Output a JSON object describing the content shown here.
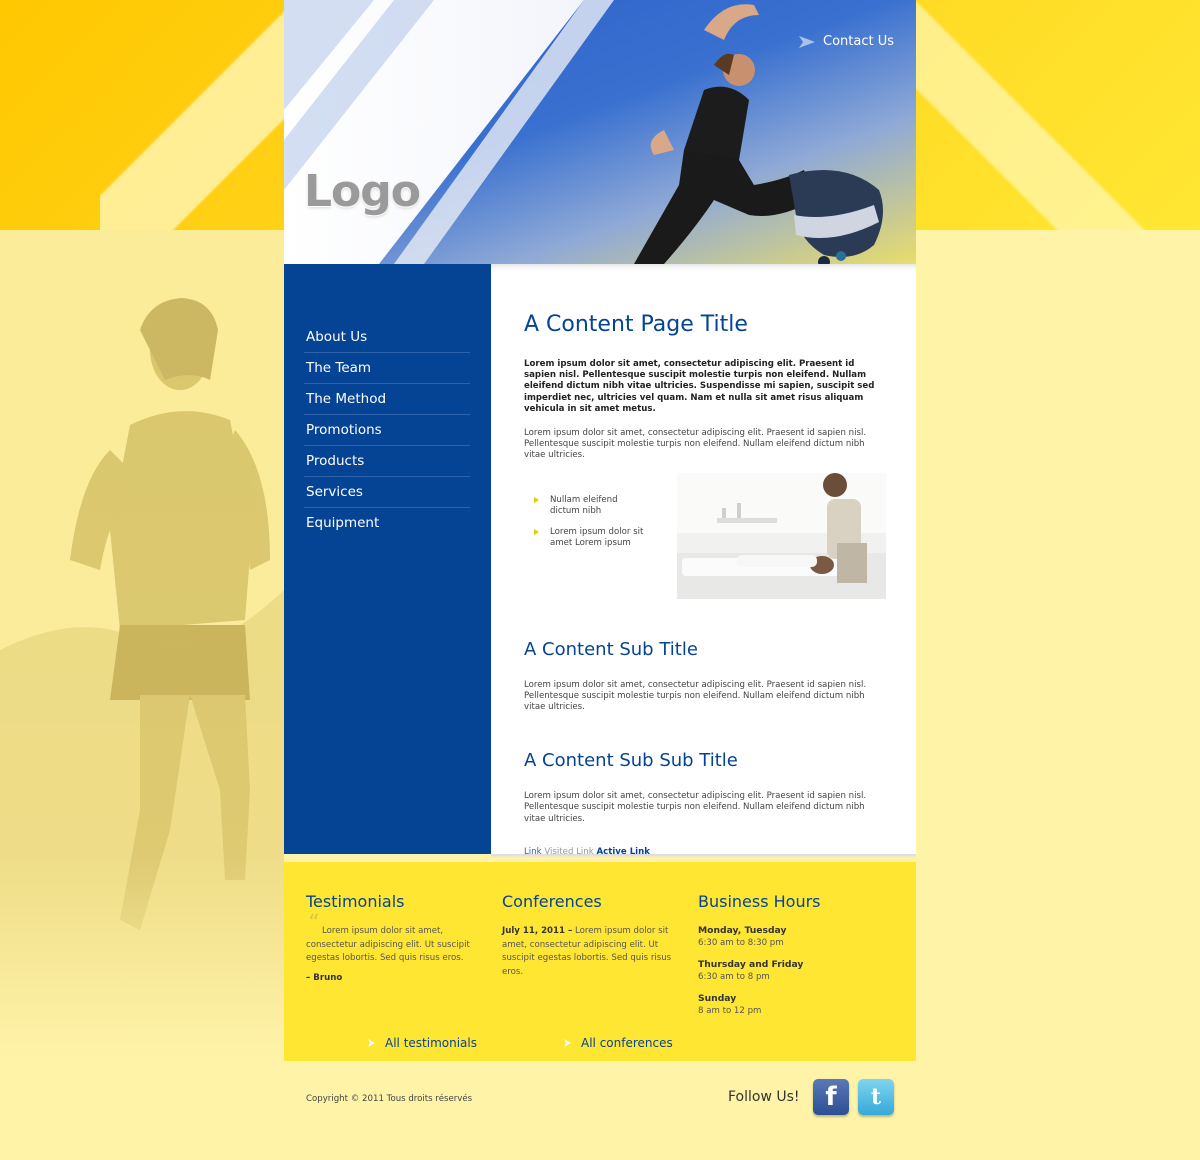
{
  "header": {
    "logo": "Logo",
    "contact_label": "Contact Us"
  },
  "nav": {
    "items": [
      {
        "label": "About Us"
      },
      {
        "label": "The Team"
      },
      {
        "label": "The Method"
      },
      {
        "label": "Promotions"
      },
      {
        "label": "Products"
      },
      {
        "label": "Services"
      },
      {
        "label": "Equipment"
      }
    ]
  },
  "content": {
    "title": "A Content Page Title",
    "lead": "Lorem ipsum dolor sit amet, consectetur adipiscing elit. Praesent id sapien nisl. Pellentesque suscipit molestie turpis non eleifend. Nullam eleifend dictum nibh vitae ultricies. Suspendisse mi sapien, suscipit sed imperdiet nec, ultricies vel quam. Nam et nulla sit amet risus aliquam vehicula in sit amet metus.",
    "intro": "Lorem ipsum dolor sit amet, consectetur adipiscing elit. Praesent id sapien nisl. Pellentesque suscipit molestie turpis non eleifend. Nullam eleifend dictum nibh vitae ultricies.",
    "bullets": [
      "Nullam eleifend dictum nibh",
      "Lorem ipsum dolor sit amet Lorem ipsum"
    ],
    "subtitle": "A Content Sub Title",
    "sub_para": "Lorem ipsum dolor sit amet, consectetur adipiscing elit. Praesent id sapien nisl. Pellentesque suscipit molestie turpis non eleifend. Nullam eleifend dictum nibh vitae ultricies.",
    "subsubtitle": "A Content Sub Sub Title",
    "subsub_para": "Lorem ipsum dolor sit amet, consectetur adipiscing elit. Praesent id sapien nisl. Pellentesque suscipit molestie turpis non eleifend. Nullam eleifend dictum nibh vitae ultricies.",
    "links": {
      "link": "Link",
      "visited": "Visited Link",
      "active": "Active Link"
    }
  },
  "testimonials": {
    "title": "Testimonials",
    "quote": "Lorem ipsum dolor sit amet, consectetur adipiscing elit. Ut suscipit egestas lobortis. Sed quis risus eros.",
    "author": "– Bruno",
    "more": "All testimonials"
  },
  "conferences": {
    "title": "Conferences",
    "date": "July 11, 2011 –",
    "text": "Lorem ipsum dolor sit amet, consectetur adipiscing elit. Ut suscipit egestas lobortis. Sed quis risus eros.",
    "more": "All conferences"
  },
  "hours": {
    "title": "Business Hours",
    "rows": [
      {
        "label": "Monday, Tuesday",
        "value": "6:30 am to 8:30 pm"
      },
      {
        "label": "Thursday and Friday",
        "value": "6:30 am to 8 pm"
      },
      {
        "label": "Sunday",
        "value": "8 am to 12 pm"
      }
    ]
  },
  "footer": {
    "copyright": "Copyright © 2011 Tous droits réservés",
    "follow": "Follow Us!",
    "facebook_glyph": "f",
    "twitter_glyph": "t"
  },
  "colors": {
    "brand_blue": "#054394",
    "brand_yellow": "#ffe633",
    "page_bg": "#fff3a8"
  }
}
